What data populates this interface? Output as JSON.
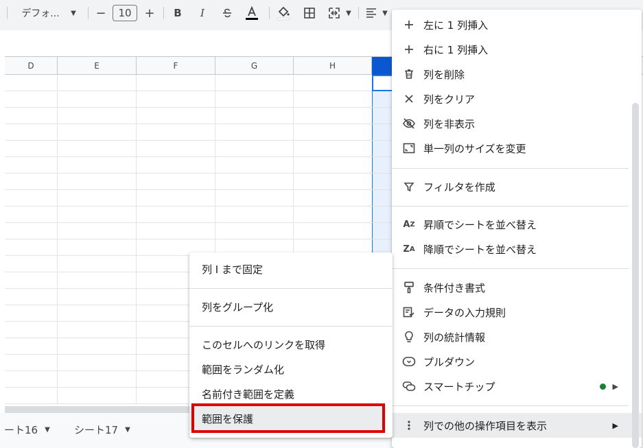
{
  "toolbar": {
    "font_name": "デフォ...",
    "font_size": "10",
    "decrease": "−",
    "increase": "+",
    "bold": "B",
    "italic": "I"
  },
  "columns": [
    "D",
    "E",
    "F",
    "G",
    "H"
  ],
  "sheets": [
    "ート16",
    "シート17"
  ],
  "context_menu_main": [
    {
      "label": "左に 1 列挿入",
      "icon": "plus-icon"
    },
    {
      "label": "右に 1 列挿入",
      "icon": "plus-icon"
    },
    {
      "label": "列を削除",
      "icon": "trash-icon"
    },
    {
      "label": "列をクリア",
      "icon": "close-icon"
    },
    {
      "label": "列を非表示",
      "icon": "eye-off-icon"
    },
    {
      "label": "単一列のサイズを変更",
      "icon": "resize-icon"
    },
    {
      "label": "フィルタを作成",
      "icon": "filter-icon"
    },
    {
      "label": "昇順でシートを並べ替え",
      "icon": "sort-az-icon"
    },
    {
      "label": "降順でシートを並べ替え",
      "icon": "sort-za-icon"
    },
    {
      "label": "条件付き書式",
      "icon": "paint-roller-icon"
    },
    {
      "label": "データの入力規則",
      "icon": "data-validation-icon"
    },
    {
      "label": "列の統計情報",
      "icon": "lightbulb-icon"
    },
    {
      "label": "プルダウン",
      "icon": "dropdown-chip-icon"
    },
    {
      "label": "スマートチップ",
      "icon": "smart-chip-icon"
    },
    {
      "label": "列での他の操作項目を表示",
      "icon": "more-vert-icon"
    }
  ],
  "context_menu_sub": [
    {
      "label": "列 I まで固定"
    },
    {
      "label": "列をグループ化"
    },
    {
      "label": "このセルへのリンクを取得"
    },
    {
      "label": "範囲をランダム化"
    },
    {
      "label": "名前付き範囲を定義"
    },
    {
      "label": "範囲を保護"
    }
  ],
  "colors": {
    "accent": "#0b57d0",
    "highlight_box": "#e00000",
    "smart_chip_dot": "#188038"
  }
}
